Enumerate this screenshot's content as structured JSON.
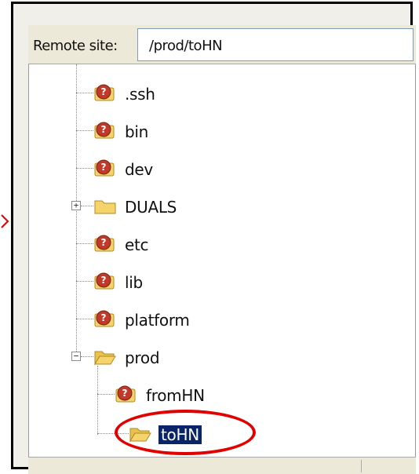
{
  "address_bar": {
    "label": "Remote site:",
    "value": "/prod/toHN"
  },
  "tree": {
    "items": [
      {
        "label": ".ssh",
        "icon": "unknown-folder-icon",
        "expander": null
      },
      {
        "label": "bin",
        "icon": "unknown-folder-icon",
        "expander": null
      },
      {
        "label": "dev",
        "icon": "unknown-folder-icon",
        "expander": null
      },
      {
        "label": "DUALS",
        "icon": "folder-icon",
        "expander": "+"
      },
      {
        "label": "etc",
        "icon": "unknown-folder-icon",
        "expander": null
      },
      {
        "label": "lib",
        "icon": "unknown-folder-icon",
        "expander": null
      },
      {
        "label": "platform",
        "icon": "unknown-folder-icon",
        "expander": null
      },
      {
        "label": "prod",
        "icon": "folder-open-icon",
        "expander": "−"
      },
      {
        "label": "fromHN",
        "icon": "unknown-folder-icon",
        "expander": null
      },
      {
        "label": "toHN",
        "icon": "folder-open-icon",
        "expander": null,
        "selected": true
      }
    ]
  },
  "colors": {
    "selection_bg": "#0a246a",
    "annotation_red": "#e10000",
    "folder_yellow": "#f5d56b"
  }
}
